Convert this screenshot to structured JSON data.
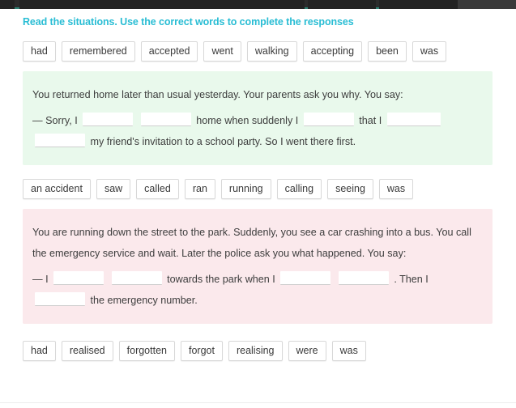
{
  "chrome": {
    "tabs": [
      "",
      "",
      "",
      ""
    ]
  },
  "task": {
    "heading": "Read the situations. Use the correct words to complete the responses"
  },
  "word_banks": [
    {
      "id": "bank-1",
      "words": [
        "had",
        "remembered",
        "accepted",
        "went",
        "walking",
        "accepting",
        "been",
        "was"
      ]
    },
    {
      "id": "bank-2",
      "words": [
        "an accident",
        "saw",
        "called",
        "ran",
        "running",
        "calling",
        "seeing",
        "was"
      ]
    },
    {
      "id": "bank-3",
      "words": [
        "had",
        "realised",
        "forgotten",
        "forgot",
        "realising",
        "were",
        "was"
      ]
    }
  ],
  "situations": [
    {
      "id": "situation-1",
      "color": "#e9f9ec",
      "prompt": "You returned home later than usual yesterday. Your parents ask you why. You say:",
      "answer_parts": [
        "— Sorry, I",
        "",
        "",
        "home when suddenly I",
        "",
        "that I",
        "",
        "",
        "my friend's invitation to a school party. So I went there first."
      ]
    },
    {
      "id": "situation-2",
      "color": "#fbe9ec",
      "prompt": "You are running down the street to the park. Suddenly, you see a car crashing into a bus. You call the emergency service and wait. Later the police ask you what happened. You say:",
      "answer_parts": [
        "— I",
        "",
        "",
        "towards the park when I",
        "",
        "",
        ". Then I",
        "",
        "the emergency number."
      ]
    }
  ],
  "colors": {
    "heading": "#29bdd4",
    "green_block": "#e9f9ec",
    "pink_block": "#fbe9ec",
    "chrome_bar": "#2c2c2c",
    "chrome_accent": "#2f7f72",
    "chip_border": "#d8d8d8",
    "blank_underline": "#cfcfcf",
    "body_text": "#3d3d3d"
  }
}
